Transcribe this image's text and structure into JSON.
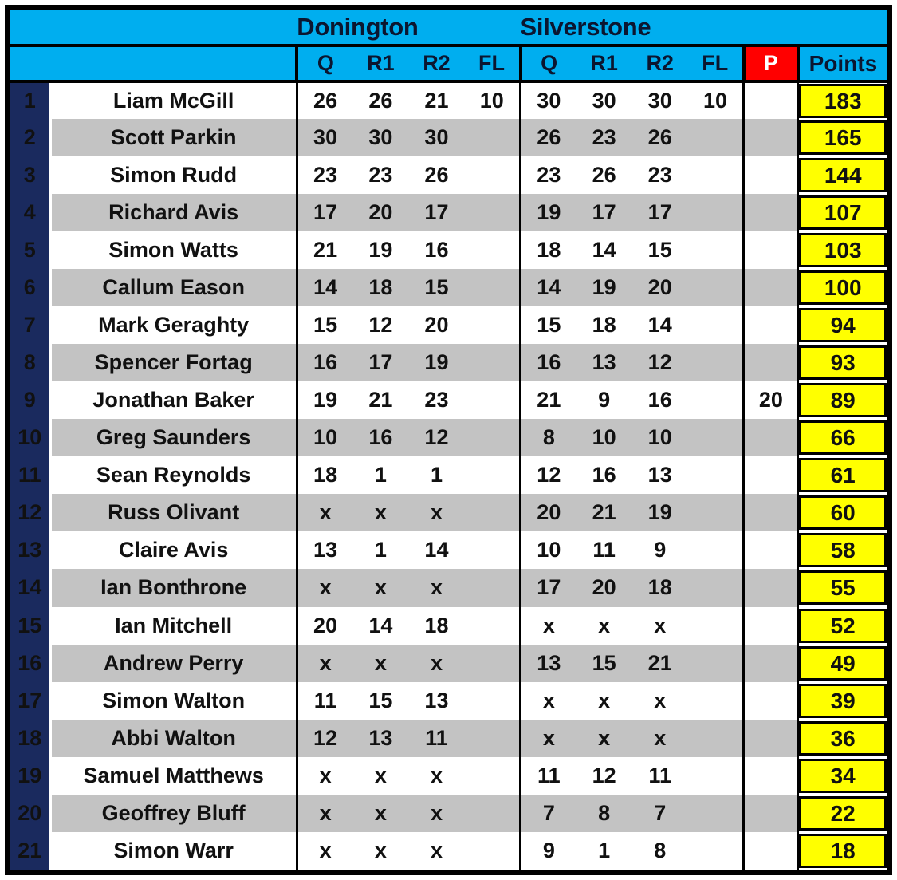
{
  "table": {
    "venues": [
      {
        "name": "Donington",
        "sessions": [
          "Q",
          "R1",
          "R2",
          "FL"
        ]
      },
      {
        "name": "Silverstone",
        "sessions": [
          "Q",
          "R1",
          "R2",
          "FL"
        ]
      }
    ],
    "penalty_header": "P",
    "points_header": "Points",
    "colors": {
      "header_cyan": "#00AEEF",
      "header_red": "#FF0000",
      "rank_navy": "#1A2A5E",
      "points_yellow": "#FFFF00",
      "alt_row_gray": "#C3C3C3",
      "penalty_text_red": "#E00000"
    },
    "rows": [
      {
        "rank": "1",
        "name": "Liam McGill",
        "d": [
          "26",
          "26",
          "21",
          "10"
        ],
        "s": [
          "30",
          "30",
          "30",
          "10"
        ],
        "p": "",
        "points": "183"
      },
      {
        "rank": "2",
        "name": "Scott Parkin",
        "d": [
          "30",
          "30",
          "30",
          ""
        ],
        "s": [
          "26",
          "23",
          "26",
          ""
        ],
        "p": "",
        "points": "165"
      },
      {
        "rank": "3",
        "name": "Simon Rudd",
        "d": [
          "23",
          "23",
          "26",
          ""
        ],
        "s": [
          "23",
          "26",
          "23",
          ""
        ],
        "p": "",
        "points": "144"
      },
      {
        "rank": "4",
        "name": "Richard Avis",
        "d": [
          "17",
          "20",
          "17",
          ""
        ],
        "s": [
          "19",
          "17",
          "17",
          ""
        ],
        "p": "",
        "points": "107"
      },
      {
        "rank": "5",
        "name": "Simon Watts",
        "d": [
          "21",
          "19",
          "16",
          ""
        ],
        "s": [
          "18",
          "14",
          "15",
          ""
        ],
        "p": "",
        "points": "103"
      },
      {
        "rank": "6",
        "name": "Callum Eason",
        "d": [
          "14",
          "18",
          "15",
          ""
        ],
        "s": [
          "14",
          "19",
          "20",
          ""
        ],
        "p": "",
        "points": "100"
      },
      {
        "rank": "7",
        "name": "Mark Geraghty",
        "d": [
          "15",
          "12",
          "20",
          ""
        ],
        "s": [
          "15",
          "18",
          "14",
          ""
        ],
        "p": "",
        "points": "94"
      },
      {
        "rank": "8",
        "name": "Spencer Fortag",
        "d": [
          "16",
          "17",
          "19",
          ""
        ],
        "s": [
          "16",
          "13",
          "12",
          ""
        ],
        "p": "",
        "points": "93"
      },
      {
        "rank": "9",
        "name": "Jonathan Baker",
        "d": [
          "19",
          "21",
          "23",
          ""
        ],
        "s": [
          "21",
          "9",
          "16",
          ""
        ],
        "p": "20",
        "points": "89"
      },
      {
        "rank": "10",
        "name": "Greg Saunders",
        "d": [
          "10",
          "16",
          "12",
          ""
        ],
        "s": [
          "8",
          "10",
          "10",
          ""
        ],
        "p": "",
        "points": "66"
      },
      {
        "rank": "11",
        "name": "Sean Reynolds",
        "d": [
          "18",
          "1",
          "1",
          ""
        ],
        "s": [
          "12",
          "16",
          "13",
          ""
        ],
        "p": "",
        "points": "61"
      },
      {
        "rank": "12",
        "name": "Russ Olivant",
        "d": [
          "x",
          "x",
          "x",
          ""
        ],
        "s": [
          "20",
          "21",
          "19",
          ""
        ],
        "p": "",
        "points": "60"
      },
      {
        "rank": "13",
        "name": "Claire Avis",
        "d": [
          "13",
          "1",
          "14",
          ""
        ],
        "s": [
          "10",
          "11",
          "9",
          ""
        ],
        "p": "",
        "points": "58"
      },
      {
        "rank": "14",
        "name": "Ian Bonthrone",
        "d": [
          "x",
          "x",
          "x",
          ""
        ],
        "s": [
          "17",
          "20",
          "18",
          ""
        ],
        "p": "",
        "points": "55"
      },
      {
        "rank": "15",
        "name": "Ian Mitchell",
        "d": [
          "20",
          "14",
          "18",
          ""
        ],
        "s": [
          "x",
          "x",
          "x",
          ""
        ],
        "p": "",
        "points": "52"
      },
      {
        "rank": "16",
        "name": "Andrew Perry",
        "d": [
          "x",
          "x",
          "x",
          ""
        ],
        "s": [
          "13",
          "15",
          "21",
          ""
        ],
        "p": "",
        "points": "49"
      },
      {
        "rank": "17",
        "name": "Simon Walton",
        "d": [
          "11",
          "15",
          "13",
          ""
        ],
        "s": [
          "x",
          "x",
          "x",
          ""
        ],
        "p": "",
        "points": "39"
      },
      {
        "rank": "18",
        "name": "Abbi Walton",
        "d": [
          "12",
          "13",
          "11",
          ""
        ],
        "s": [
          "x",
          "x",
          "x",
          ""
        ],
        "p": "",
        "points": "36"
      },
      {
        "rank": "19",
        "name": "Samuel Matthews",
        "d": [
          "x",
          "x",
          "x",
          ""
        ],
        "s": [
          "11",
          "12",
          "11",
          ""
        ],
        "p": "",
        "points": "34"
      },
      {
        "rank": "20",
        "name": "Geoffrey Bluff",
        "d": [
          "x",
          "x",
          "x",
          ""
        ],
        "s": [
          "7",
          "8",
          "7",
          ""
        ],
        "p": "",
        "points": "22"
      },
      {
        "rank": "21",
        "name": "Simon Warr",
        "d": [
          "x",
          "x",
          "x",
          ""
        ],
        "s": [
          "9",
          "1",
          "8",
          ""
        ],
        "p": "",
        "points": "18"
      }
    ]
  }
}
